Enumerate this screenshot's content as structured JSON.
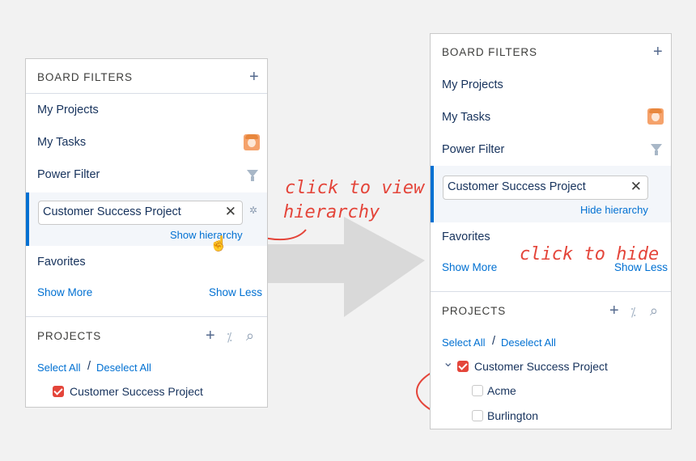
{
  "left": {
    "header": "BOARD FILTERS",
    "filters": [
      "My Projects",
      "My Tasks",
      "Power Filter"
    ],
    "search_value": "Customer Success Project",
    "show_hierarchy": "Show hierarchy",
    "favorites": "Favorites",
    "show_more": "Show More",
    "show_less": "Show Less",
    "projects_header": "PROJECTS",
    "select_all": "Select All",
    "separator": "/",
    "deselect_all": "Deselect All",
    "project": "Customer Success Project"
  },
  "right": {
    "header": "BOARD FILTERS",
    "filters": [
      "My Projects",
      "My Tasks",
      "Power Filter"
    ],
    "search_value": "Customer Success Project",
    "hide_hierarchy": "Hide hierarchy",
    "favorites": "Favorites",
    "show_more": "Show More",
    "show_less": "Show Less",
    "projects_header": "PROJECTS",
    "select_all": "Select All",
    "separator": "/",
    "deselect_all": "Deselect All",
    "tree": {
      "parent": "Customer Success Project",
      "children": [
        "Acme",
        "Burlington"
      ]
    }
  },
  "annotations": {
    "view": [
      "click to view",
      "hierarchy"
    ],
    "hide": "click to hide"
  },
  "symbols": {
    "plus": "+",
    "close": "✕",
    "gear": "✲",
    "wand": "⁒",
    "search": "⌕",
    "chevron": "⌄",
    "pointer": "☝"
  },
  "colors": {
    "accent": "#0070d2",
    "annotation": "#e4453a",
    "checkbox": "#e4453a"
  }
}
